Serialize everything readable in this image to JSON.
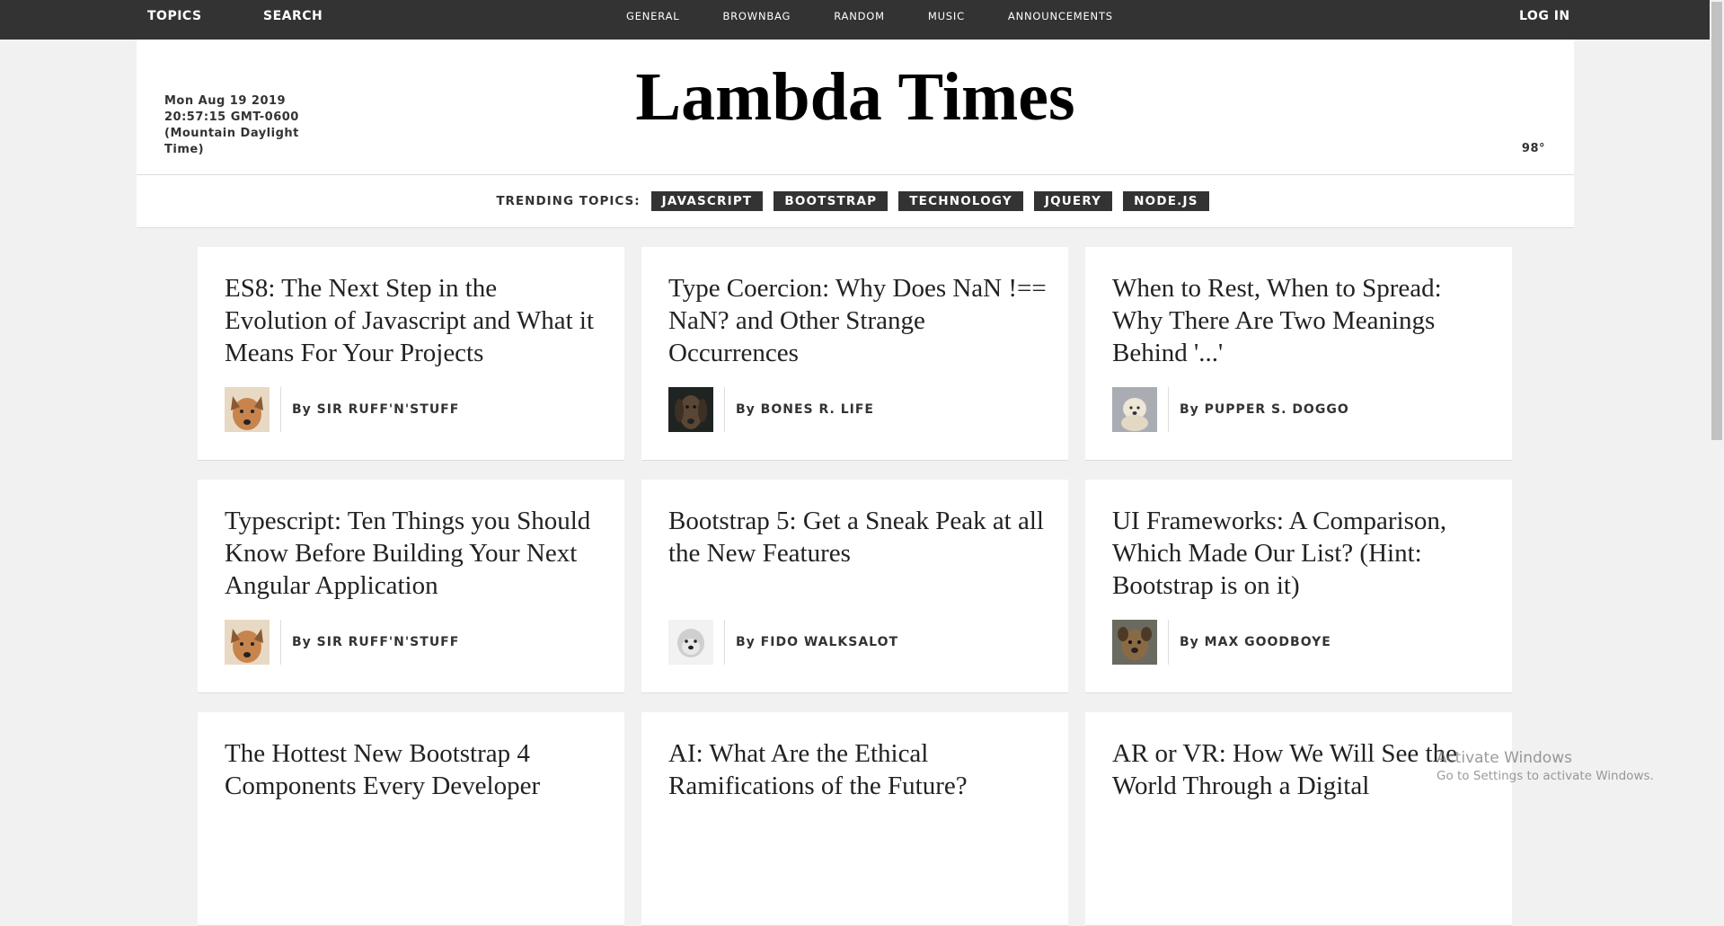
{
  "topbar": {
    "topics": "TOPICS",
    "search": "SEARCH",
    "nav": [
      "GENERAL",
      "BROWNBAG",
      "RANDOM",
      "MUSIC",
      "ANNOUNCEMENTS"
    ],
    "login": "LOG IN"
  },
  "header": {
    "date": "Mon Aug 19 2019 20:57:15 GMT-0600 (Mountain Daylight Time)",
    "title": "Lambda Times",
    "temp": "98°"
  },
  "trending": {
    "label": "TRENDING TOPICS:",
    "tags": [
      "JAVASCRIPT",
      "BOOTSTRAP",
      "TECHNOLOGY",
      "JQUERY",
      "NODE.JS"
    ]
  },
  "cards": [
    {
      "headline": "ES8: The Next Step in the Evolution of Javascript and What it Means For Your Projects",
      "author": "By SIR RUFF'N'STUFF",
      "avatar_color": "#c7844c"
    },
    {
      "headline": "Type Coercion: Why Does NaN !== NaN? and Other Strange Occurrences",
      "author": "By BONES R. LIFE",
      "avatar_color": "#4a4036"
    },
    {
      "headline": "When to Rest, When to Spread: Why There Are Two Meanings Behind '...'",
      "author": "By PUPPER S. DOGGO",
      "avatar_color": "#e9e1d2"
    },
    {
      "headline": "Typescript: Ten Things you Should Know Before Building Your Next Angular Application",
      "author": "By SIR RUFF'N'STUFF",
      "avatar_color": "#c7844c"
    },
    {
      "headline": "Bootstrap 5: Get a Sneak Peak at all the New Features",
      "author": "By FIDO WALKSALOT",
      "avatar_color": "#d9d9d9"
    },
    {
      "headline": "UI Frameworks: A Comparison, Which Made Our List? (Hint: Bootstrap is on it)",
      "author": "By MAX GOODBOYE",
      "avatar_color": "#8a6a45"
    },
    {
      "headline": "The Hottest New Bootstrap 4 Components Every Developer",
      "author": "",
      "avatar_color": ""
    },
    {
      "headline": "AI: What Are the Ethical Ramifications of the Future?",
      "author": "",
      "avatar_color": ""
    },
    {
      "headline": "AR or VR: How We Will See the World Through a Digital",
      "author": "",
      "avatar_color": ""
    }
  ],
  "watermark": {
    "line1": "Activate Windows",
    "line2": "Go to Settings to activate Windows."
  }
}
